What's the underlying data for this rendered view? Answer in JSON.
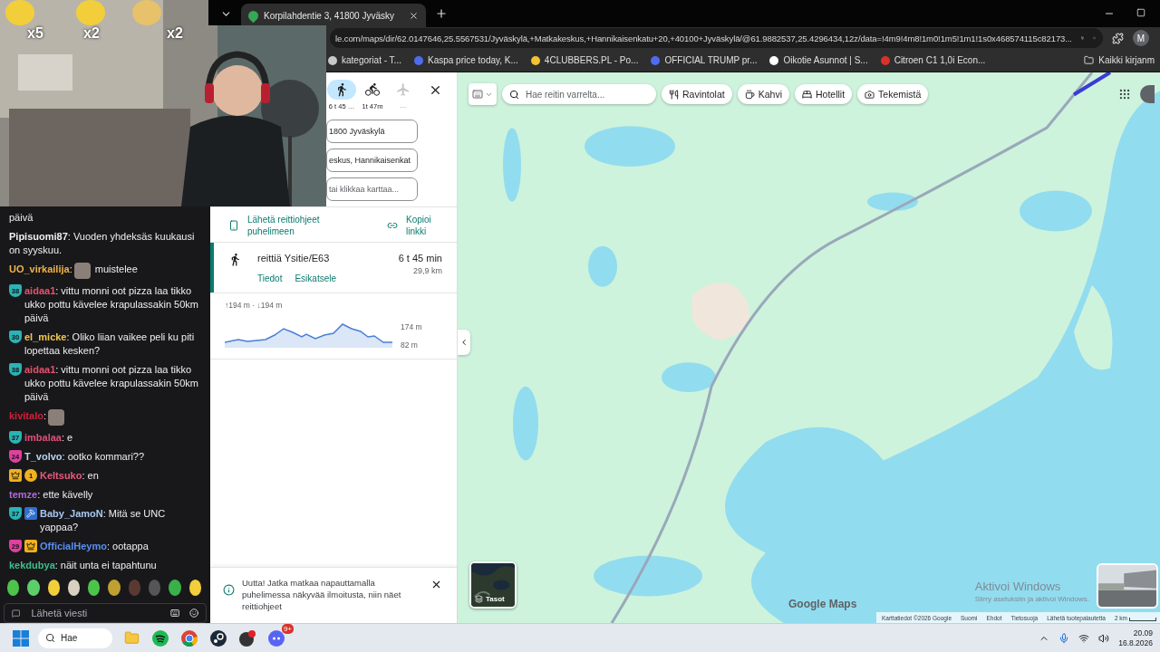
{
  "stream_overlay": {
    "counters": [
      "x5",
      "x2",
      "x2"
    ]
  },
  "browser": {
    "tab": {
      "title": "Korpilahdentie 3, 41800 Jyväsky"
    },
    "address": "le.com/maps/dir/62.0147646,25.5567531/Jyväskylä,+Matkakeskus,+Hannikaisenkatu+20,+40100+Jyväskylä/@61.9882537,25.4296434,12z/data=!4m9!4m8!1m0!1m5!1m1!1s0x468574115c82173...",
    "bookmarks": [
      {
        "label": "kategoriat - T...",
        "color": "#c8c8c8"
      },
      {
        "label": "Kaspa price today, K...",
        "color": "#4f6cf0"
      },
      {
        "label": "4CLUBBERS.PL - Po...",
        "color": "#f2c230"
      },
      {
        "label": "OFFICIAL TRUMP pr...",
        "color": "#4f6cf0"
      },
      {
        "label": "Oikotie Asunnot | S...",
        "color": "#ffffff"
      },
      {
        "label": "Citroen C1 1,0i Econ...",
        "color": "#d8332a"
      }
    ],
    "other_bookmarks": "Kaikki kirjanm",
    "profile": "M"
  },
  "chat": {
    "messages": [
      {
        "parts": [
          {
            "kind": "text",
            "text": "päivä"
          }
        ]
      },
      {
        "user": "Pipisuomi87",
        "color": "#efeff1",
        "parts": [
          {
            "kind": "text",
            "text": ": Vuoden yhdeksäs kuukausi on syyskuu."
          }
        ]
      },
      {
        "user": "UO_virkailija",
        "color": "#f0b24a",
        "parts": [
          {
            "kind": "text",
            "text": ":"
          },
          {
            "kind": "emote"
          },
          {
            "kind": "text",
            "text": " muistelee"
          }
        ]
      },
      {
        "user": "aidaa1",
        "color": "#e8506e",
        "badges": [
          {
            "kind": "number",
            "text": "38",
            "color": "#2bb3b5"
          }
        ],
        "parts": [
          {
            "kind": "text",
            "text": ": vittu monni oot pizza laa tikko ukko pottu kävelee krapulassakin 50km päivä"
          }
        ]
      },
      {
        "user": "el_micke",
        "color": "#f2c94c",
        "badges": [
          {
            "kind": "number",
            "text": "30",
            "color": "#2bb3b5"
          }
        ],
        "parts": [
          {
            "kind": "text",
            "text": ": Oliko liian vaikee peli ku piti lopettaa kesken?"
          }
        ]
      },
      {
        "user": "aidaa1",
        "color": "#e8506e",
        "badges": [
          {
            "kind": "number",
            "text": "38",
            "color": "#2bb3b5"
          }
        ],
        "parts": [
          {
            "kind": "text",
            "text": ": vittu monni oot pizza laa tikko ukko pottu kävelee krapulassakin 50km päivä"
          }
        ]
      },
      {
        "user": "kivitalo",
        "color": "#d0203a",
        "parts": [
          {
            "kind": "text",
            "text": ":"
          },
          {
            "kind": "emote"
          }
        ]
      },
      {
        "user": "imbalaa",
        "color": "#e0507a",
        "badges": [
          {
            "kind": "number",
            "text": "37",
            "color": "#2bb3b5"
          }
        ],
        "parts": [
          {
            "kind": "text",
            "text": ": e"
          }
        ]
      },
      {
        "user": "T_volvo",
        "color": "#b8d4f0",
        "badges": [
          {
            "kind": "number",
            "text": "24",
            "color": "#e040a0"
          }
        ],
        "parts": [
          {
            "kind": "text",
            "text": ": ootko kommari??"
          }
        ]
      },
      {
        "user": "Keltsuko",
        "color": "#e85a7a",
        "badges": [
          {
            "kind": "crown"
          },
          {
            "kind": "coin",
            "text": "1",
            "color": "#f0b020"
          }
        ],
        "parts": [
          {
            "kind": "text",
            "text": ": en"
          }
        ]
      },
      {
        "user": "temze",
        "color": "#b06ad8",
        "parts": [
          {
            "kind": "text",
            "text": ": ette kävelly"
          }
        ]
      },
      {
        "user": "Baby_JamoN",
        "color": "#a8c8f0",
        "badges": [
          {
            "kind": "number",
            "text": "37",
            "color": "#2bb3b5"
          },
          {
            "kind": "hammer"
          }
        ],
        "parts": [
          {
            "kind": "text",
            "text": ": Mitä se UNC yappaa?"
          }
        ]
      },
      {
        "user": "OfficialHeymo",
        "color": "#5a8ff0",
        "badges": [
          {
            "kind": "number",
            "text": "29",
            "color": "#e040a0"
          },
          {
            "kind": "crown"
          }
        ],
        "parts": [
          {
            "kind": "text",
            "text": ": ootappa"
          }
        ]
      },
      {
        "user": "kekdubya",
        "color": "#3dbf8a",
        "parts": [
          {
            "kind": "text",
            "text": ": näit unta ei tapahtunu"
          }
        ]
      }
    ],
    "input": {
      "placeholder": "Lähetä viesti"
    }
  },
  "directions": {
    "modes": [
      {
        "kind": "walk",
        "label": "6 t 45 …",
        "selected": true,
        "disabled": false
      },
      {
        "kind": "bike",
        "label": "1t 47m",
        "selected": false,
        "disabled": false
      },
      {
        "kind": "plane",
        "label": "—",
        "selected": false,
        "disabled": true
      }
    ],
    "fields": [
      {
        "value": "1800 Jyväskylä"
      },
      {
        "value": "eskus, Hannikaisenkat"
      },
      {
        "placeholder": "tai klikkaa karttaa..."
      }
    ],
    "send_link": "Lähetä reittiohjeet puhelimeen",
    "copy_link": "Kopioi linkki",
    "route": {
      "selected": true,
      "name": "reittiä Ysitie/E63",
      "duration": "6 t 45 min",
      "distance": "29,9 km",
      "actions": [
        "Tiedot",
        "Esikatsele"
      ]
    },
    "elevation": {
      "summary": "↑194 m · ↓194 m",
      "max": "174 m",
      "min": "82 m"
    },
    "notice": {
      "text": "Uutta! Jatka matkaa napauttamalla puhelimessa näkyvää ilmoitusta, niin näet reittiohjeet"
    }
  },
  "map": {
    "search": {
      "placeholder": "Hae reitin varrelta..."
    },
    "chips": [
      {
        "kind": "food",
        "label": "Ravintolat"
      },
      {
        "kind": "coffee",
        "label": "Kahvi"
      },
      {
        "kind": "hotel",
        "label": "Hotellit"
      },
      {
        "kind": "camera",
        "label": "Tekemistä"
      }
    ],
    "layers_label": "Tasot",
    "logo": "Google Maps",
    "footer": [
      "Karttatiedot ©2026 Google",
      "Suomi",
      "Ehdot",
      "Tietosuoja",
      "Lähetä tuotepalautetta"
    ],
    "scale": "2 km",
    "windows_notice": {
      "title": "Aktivoi Windows",
      "subtitle": "Siirry asetuksiin ja aktivoi Windows."
    }
  },
  "taskbar": {
    "search": "Hae",
    "badge": "9+",
    "time": "20.09",
    "date": "16.8.2026"
  }
}
